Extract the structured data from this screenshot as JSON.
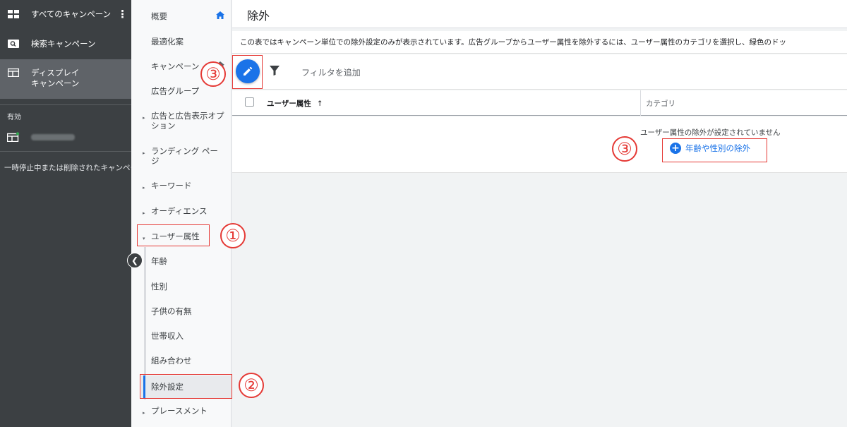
{
  "left_nav": {
    "all_campaigns": "すべてのキャンペーン",
    "search_campaign": "検索キャンペーン",
    "display_campaign": "ディスプレイ\nキャンペーン",
    "active_heading": "有効",
    "paused_removed": "一時停止中または削除されたキャンペーン"
  },
  "sub_nav": {
    "items": [
      "概要",
      "最適化案",
      "キャンペーン",
      "広告グループ",
      "広告と広告表示オプション",
      "ランディング ページ",
      "キーワード",
      "オーディエンス",
      "ユーザー属性",
      "年齢",
      "性別",
      "子供の有無",
      "世帯収入",
      "組み合わせ",
      "除外設定",
      "プレースメント"
    ]
  },
  "main": {
    "title": "除外",
    "info_text": "この表ではキャンペーン単位での除外設定のみが表示されています。広告グループからユーザー属性を除外するには、ユーザー属性のカテゴリを選択し、緑色のドッ",
    "filter_label": "フィルタを追加",
    "table": {
      "col_user_attr": "ユーザー属性",
      "col_category": "カテゴリ",
      "empty_message": "ユーザー属性の除外が設定されていません",
      "add_exclusion": "年齢や性別の除外"
    }
  },
  "annotations": [
    "①",
    "②",
    "③",
    "③"
  ],
  "colors": {
    "accent": "#1a73e8",
    "annotation": "#e53935",
    "sidebar": "#3c4043"
  }
}
